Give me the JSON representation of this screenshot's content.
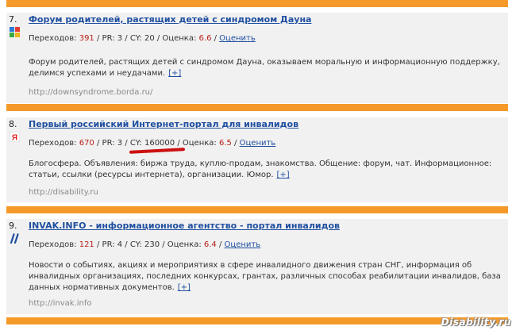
{
  "entries": [
    {
      "number": "7.",
      "title": "Форум родителей, растящих детей с синдромом Дауна",
      "visits_label": "Переходов:",
      "visits": "391",
      "pr_text": "/ PR: 3 / CY: 20 / Оценка:",
      "rating": "6.6",
      "rate_link": "Оценить",
      "description": "Форум родителей, растящих детей с синдромом Дауна, оказываем моральную и информационную поддержку, делимся успехами и неудачами.",
      "more": "[+]",
      "url": "http://downsyndrome.borda.ru/",
      "icon": "colorful-grid-icon"
    },
    {
      "number": "8.",
      "title": "Первый российский Интернет-портал для инвалидов",
      "visits_label": "Переходов:",
      "visits": "670",
      "pr_text": "/ PR: 3 / CY: 160000 / Оценка:",
      "rating": "6.5",
      "rate_link": "Оценить",
      "description": "Блогосфера. Объявления: биржа труда, куплю-продам, знакомства. Общение: форум, чат. Информационное: статьи, ссылки (ресурсы интернета), организации. Юмор.",
      "more": "[+]",
      "url": "http://disability.ru",
      "icon": "yandex-icon"
    },
    {
      "number": "9.",
      "title": "INVAK.INFO - информационное агентство - портал инвалидов",
      "visits_label": "Переходов:",
      "visits": "121",
      "pr_text": "/ PR: 4 / CY: 230 / Оценка:",
      "rating": "6.4",
      "rate_link": "Оценить",
      "description": "Новости о событиях, акциях и мероприятиях в сфере инвалидного движения стран СНГ, информация об инвалидных организациях, последних конкурсах, грантах, различных способах реабилитации инвалидов, база данных нормативных документов.",
      "more": "[+]",
      "url": "http://invak.info",
      "icon": "invak-logo-icon"
    }
  ],
  "watermark": "Disability.ru",
  "colors": {
    "bar": "#f59a2a",
    "link": "#1f4fa0",
    "accent": "#b8201a"
  }
}
